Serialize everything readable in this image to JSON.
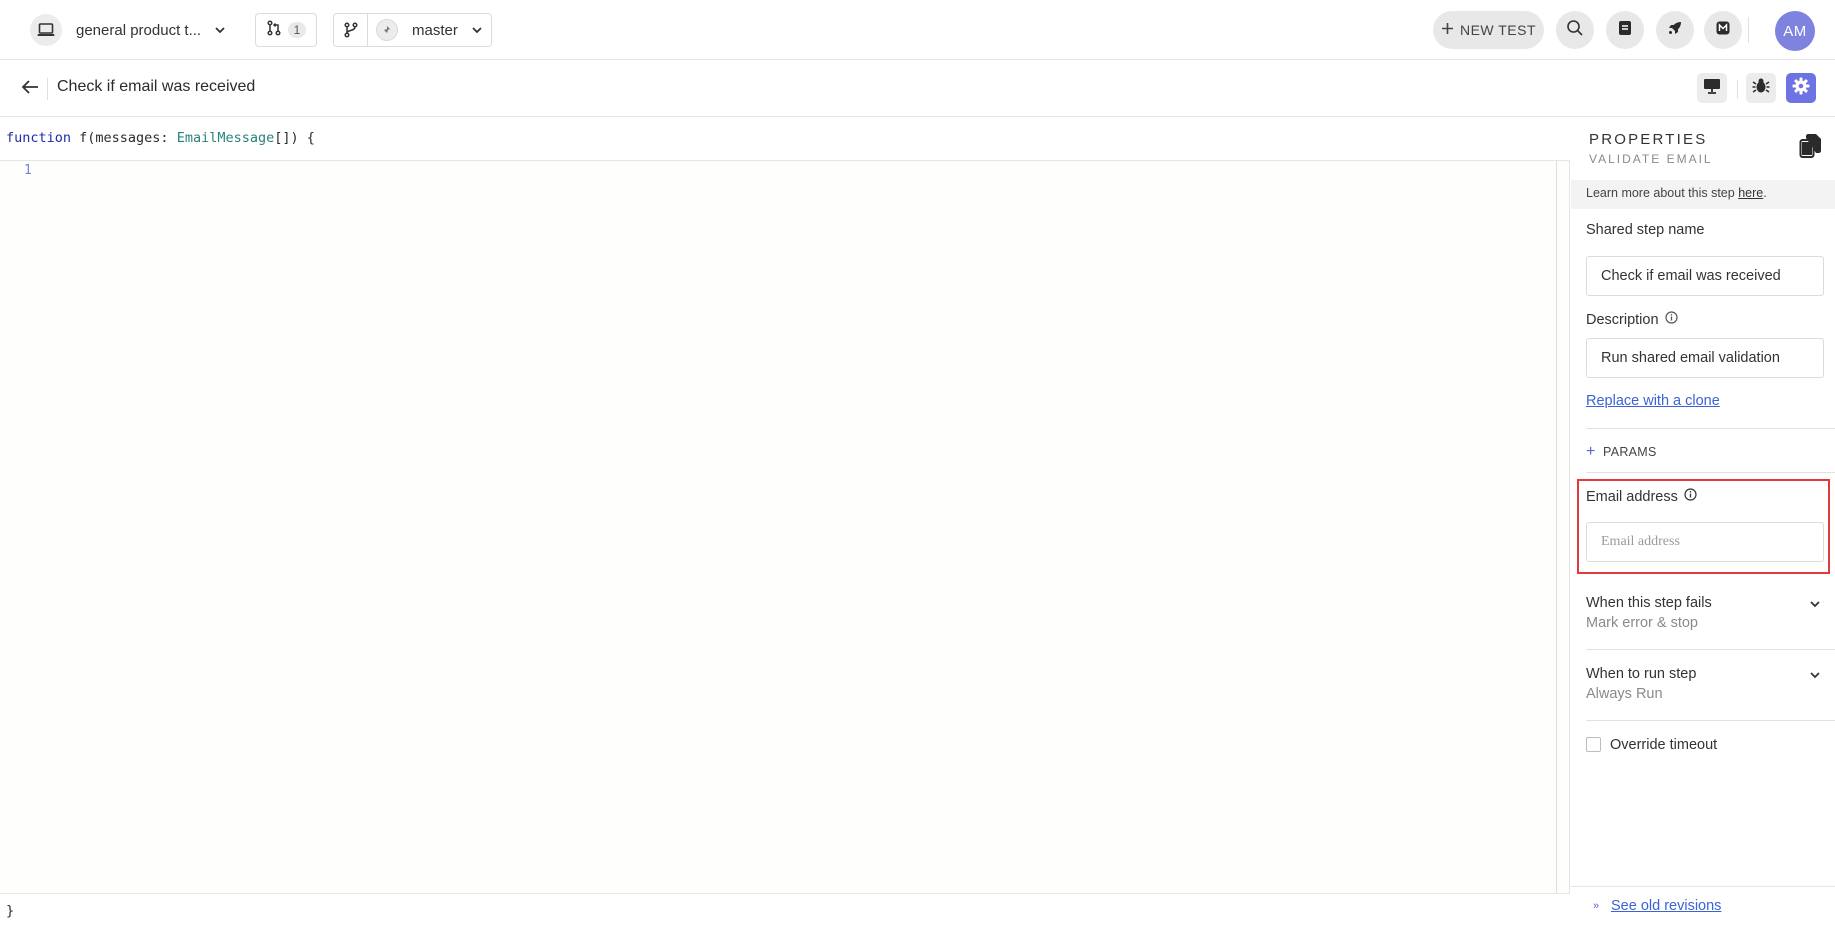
{
  "topbar": {
    "project_name": "general product t...",
    "pull_request_count": "1",
    "branch_name": "master",
    "new_test_label": "NEW TEST",
    "avatar_initials": "AM"
  },
  "titlebar": {
    "title": "Check if email was received"
  },
  "editor": {
    "header_keyword": "function",
    "header_name": " f(messages: ",
    "header_type": "EmailMessage",
    "header_rest": "[]) {",
    "line_numbers": [
      "1"
    ],
    "footer": "}"
  },
  "panel": {
    "title": "PROPERTIES",
    "subtitle": "VALIDATE EMAIL",
    "learn_prefix": "Learn more about this step ",
    "learn_link": "here",
    "learn_suffix": ".",
    "shared_step_label": "Shared step name",
    "shared_step_value": "Check if email was received",
    "description_label": "Description",
    "description_value": "Run shared email validation",
    "replace_link": "Replace with a clone",
    "params_label": "PARAMS",
    "email_label": "Email address",
    "email_placeholder": "Email address",
    "email_value": "",
    "fail_heading": "When this step fails",
    "fail_value": "Mark error & stop",
    "run_heading": "When to run step",
    "run_value": "Always Run",
    "override_label": "Override timeout",
    "override_checked": false,
    "revisions_link": "See old revisions"
  },
  "colors": {
    "accent": "#6d73e2",
    "link": "#3b63d8",
    "highlight": "#e23b3b",
    "avatar": "#7d83de"
  },
  "icons": [
    "laptop-icon",
    "chevron-down-icon",
    "pull-request-icon",
    "branch-icon",
    "pin-icon",
    "plus-icon",
    "search-icon",
    "docs-icon",
    "rocket-icon",
    "mailbox-icon",
    "arrow-left-icon",
    "monitor-icon",
    "bug-icon",
    "gear-icon",
    "copy-icon",
    "info-icon",
    "double-chevron-right-icon"
  ]
}
